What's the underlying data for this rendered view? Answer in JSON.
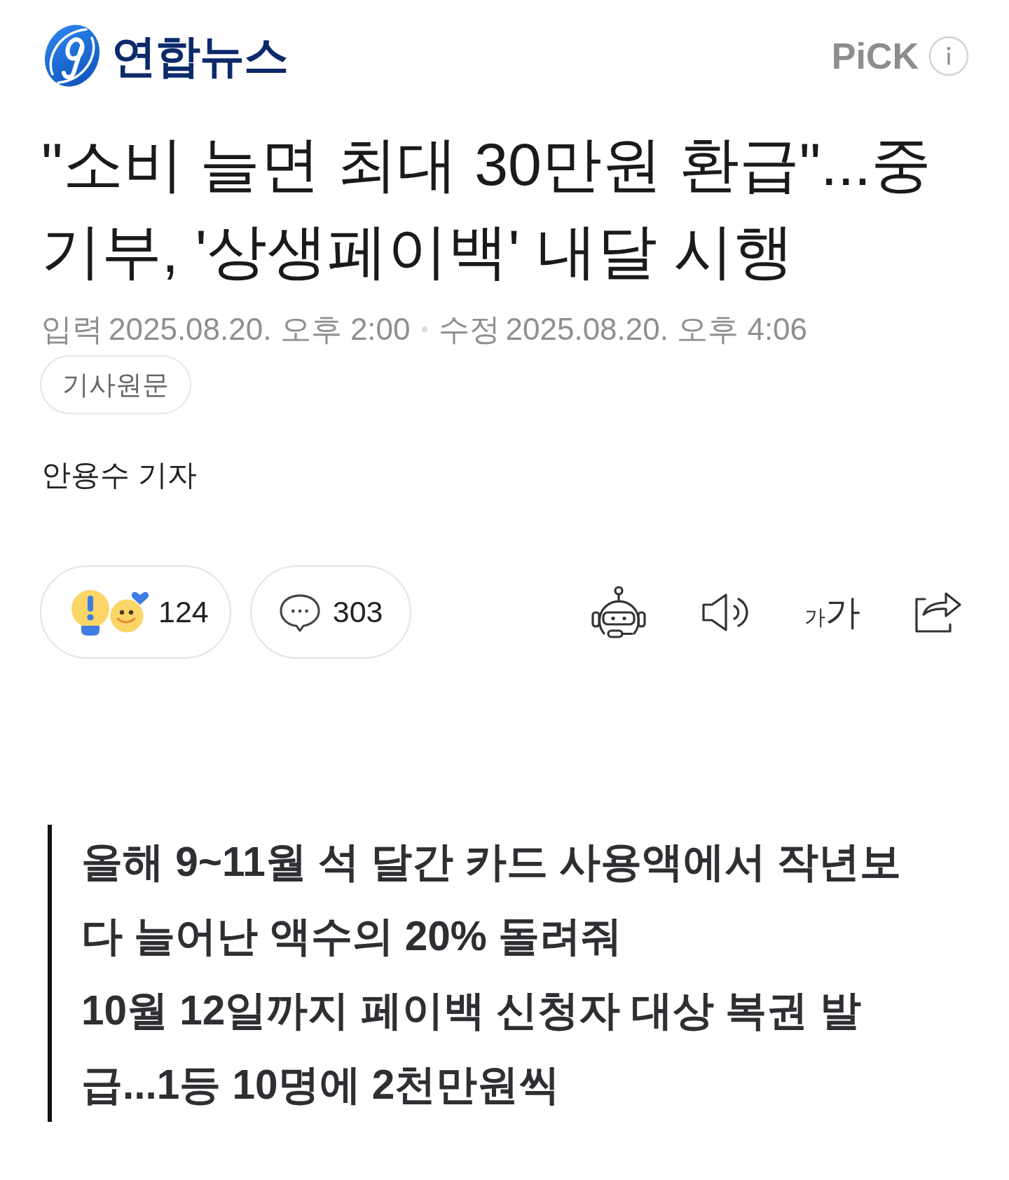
{
  "header": {
    "logo_text": "연합뉴스",
    "pick_label": "PiCK"
  },
  "article": {
    "title": "\"소비 늘면 최대 30만원 환급\"...중기부, '상생페이백' 내달 시행",
    "dates": [
      {
        "label": "입력",
        "value": "2025.08.20. 오후 2:00"
      },
      {
        "label": "수정",
        "value": "2025.08.20. 오후 4:06"
      }
    ],
    "source_button": "기사원문",
    "byline": "안용수 기자"
  },
  "actions": {
    "reaction_count": "124",
    "comment_count": "303",
    "text_size": {
      "small": "가",
      "large": "가"
    }
  },
  "summary": [
    "올해 9~11월 석 달간 카드 사용액에서 작년보다 늘어난 액수의 20% 돌려줘",
    "10월 12일까지 페이백 신청자 대상 복권 발급...1등 10명에 2천만원씩"
  ]
}
